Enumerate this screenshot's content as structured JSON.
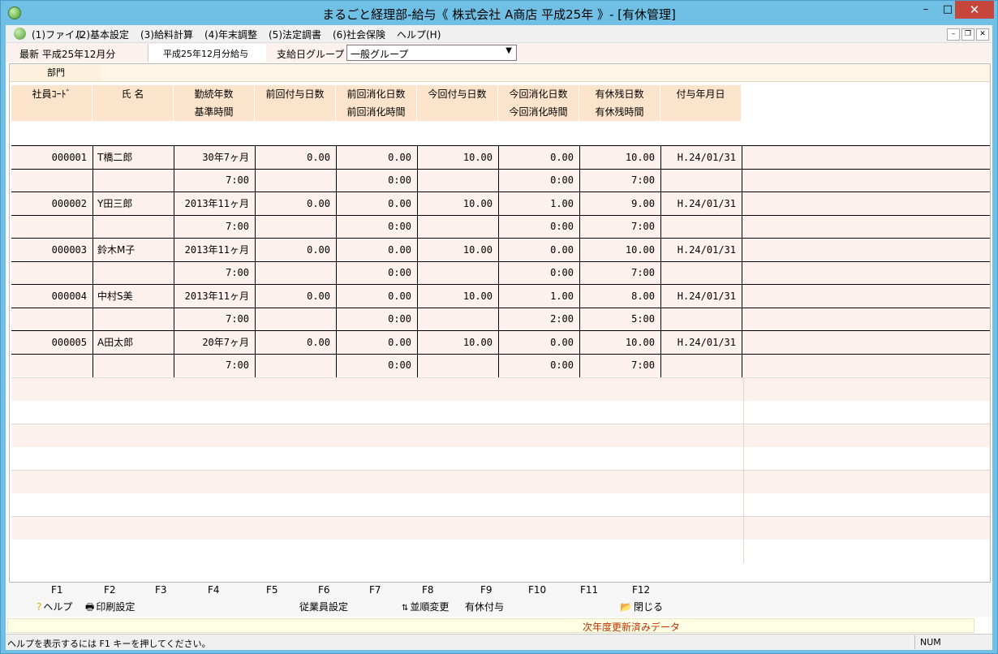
{
  "window": {
    "title": "まるごと経理部-給与《 株式会社 A商店 平成25年 》- [有休管理]"
  },
  "menu": {
    "items": [
      {
        "label": "(1)ファイル"
      },
      {
        "label": "(2)基本設定"
      },
      {
        "label": "(3)給料計算"
      },
      {
        "label": "(4)年末調整"
      },
      {
        "label": "(5)法定調書"
      },
      {
        "label": "(6)社会保険"
      },
      {
        "label": "ヘルプ(H)"
      }
    ]
  },
  "info": {
    "latest": "最新 平成25年12月分",
    "period": "平成25年12月分給与",
    "group_label": "支給日グループ",
    "group_value": "一般グループ"
  },
  "grid": {
    "dept_label": "部門",
    "headers_top": [
      "社員ｺｰﾄﾞ",
      "氏 名",
      "勤続年数",
      "前回付与日数",
      "前回消化日数",
      "今回付与日数",
      "今回消化日数",
      "有休残日数",
      "付与年月日"
    ],
    "headers_bottom": [
      "",
      "",
      "基準時間",
      "",
      "前回消化時間",
      "",
      "今回消化時間",
      "有休残時間",
      ""
    ],
    "rows": [
      {
        "code": "000001",
        "name": "T橋二郎",
        "years": "30年7ヶ月",
        "prev_grant": "0.00",
        "prev_used": "0.00",
        "cur_grant": "10.00",
        "cur_used": "0.00",
        "remain": "10.00",
        "date": "H.24/01/31",
        "base_time": "7:00",
        "prev_used_time": "0:00",
        "cur_used_time": "0:00",
        "remain_time": "7:00"
      },
      {
        "code": "000002",
        "name": "Y田三郎",
        "years": "2013年11ヶ月",
        "prev_grant": "0.00",
        "prev_used": "0.00",
        "cur_grant": "10.00",
        "cur_used": "1.00",
        "remain": "9.00",
        "date": "H.24/01/31",
        "base_time": "7:00",
        "prev_used_time": "0:00",
        "cur_used_time": "0:00",
        "remain_time": "7:00"
      },
      {
        "code": "000003",
        "name": "鈴木M子",
        "years": "2013年11ヶ月",
        "prev_grant": "0.00",
        "prev_used": "0.00",
        "cur_grant": "10.00",
        "cur_used": "0.00",
        "remain": "10.00",
        "date": "H.24/01/31",
        "base_time": "7:00",
        "prev_used_time": "0:00",
        "cur_used_time": "0:00",
        "remain_time": "7:00"
      },
      {
        "code": "000004",
        "name": "中村S美",
        "years": "2013年11ヶ月",
        "prev_grant": "0.00",
        "prev_used": "0.00",
        "cur_grant": "10.00",
        "cur_used": "1.00",
        "remain": "8.00",
        "date": "H.24/01/31",
        "base_time": "7:00",
        "prev_used_time": "0:00",
        "cur_used_time": "2:00",
        "remain_time": "5:00"
      },
      {
        "code": "000005",
        "name": "A田太郎",
        "years": "20年7ヶ月",
        "prev_grant": "0.00",
        "prev_used": "0.00",
        "cur_grant": "10.00",
        "cur_used": "0.00",
        "remain": "10.00",
        "date": "H.24/01/31",
        "base_time": "7:00",
        "prev_used_time": "0:00",
        "cur_used_time": "0:00",
        "remain_time": "7:00"
      }
    ]
  },
  "fkeys": {
    "numbers": [
      "F1",
      "F2",
      "F3",
      "F4",
      "F5",
      "F6",
      "F7",
      "F8",
      "F9",
      "F10",
      "F11",
      "F12"
    ],
    "help": "ヘルプ",
    "print": "印刷設定",
    "employee": "従業員設定",
    "sort": "並順変更",
    "grant": "有休付与",
    "close": "閉じる"
  },
  "status": {
    "message": "次年度更新済みデータ",
    "help_text": "ヘルプを表示するには F1 キーを押してください。",
    "num": "NUM"
  }
}
